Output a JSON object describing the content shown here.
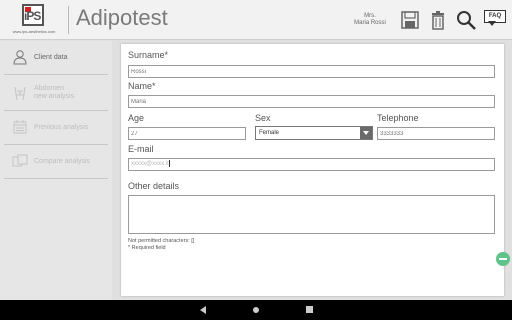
{
  "header": {
    "logo_mark": "iPS",
    "logo_url": "www.ips-aesthetics.com",
    "title": "Adipotest",
    "user_title": "Mrs.",
    "user_name": "Maria Rossi",
    "faq_label": "FAQ",
    "icons": [
      "save-icon",
      "trash-icon",
      "search-icon",
      "faq-icon"
    ]
  },
  "sidebar": {
    "items": [
      {
        "label": "Client data",
        "icon": "person-icon",
        "enabled": true
      },
      {
        "label": "Abdomen\nnew analysis",
        "icon": "abdomen-icon",
        "enabled": false
      },
      {
        "label": "Previous analysis",
        "icon": "calendar-icon",
        "enabled": false
      },
      {
        "label": "Compare analysis",
        "icon": "compare-icon",
        "enabled": false
      }
    ]
  },
  "form": {
    "surname": {
      "label": "Surname",
      "required_mark": "*",
      "placeholder": "Rossi"
    },
    "name": {
      "label": "Name",
      "required_mark": "*",
      "placeholder": "Maria"
    },
    "age": {
      "label": "Age",
      "placeholder": "27"
    },
    "sex": {
      "label": "Sex",
      "value": "Female"
    },
    "telephone": {
      "label": "Telephone",
      "placeholder": "3333333"
    },
    "email": {
      "label": "E-mail",
      "placeholder": "xxxxx@xxxx.it"
    },
    "other": {
      "label": "Other details",
      "value": ""
    },
    "note_chars": "Not permitted characters: []",
    "note_required": "* Required field"
  },
  "colors": {
    "header_bg": "#f2f2f2",
    "sidebar_bg": "#e6e6e6",
    "fab": "#5fc48a",
    "logo_red": "#d32020"
  }
}
